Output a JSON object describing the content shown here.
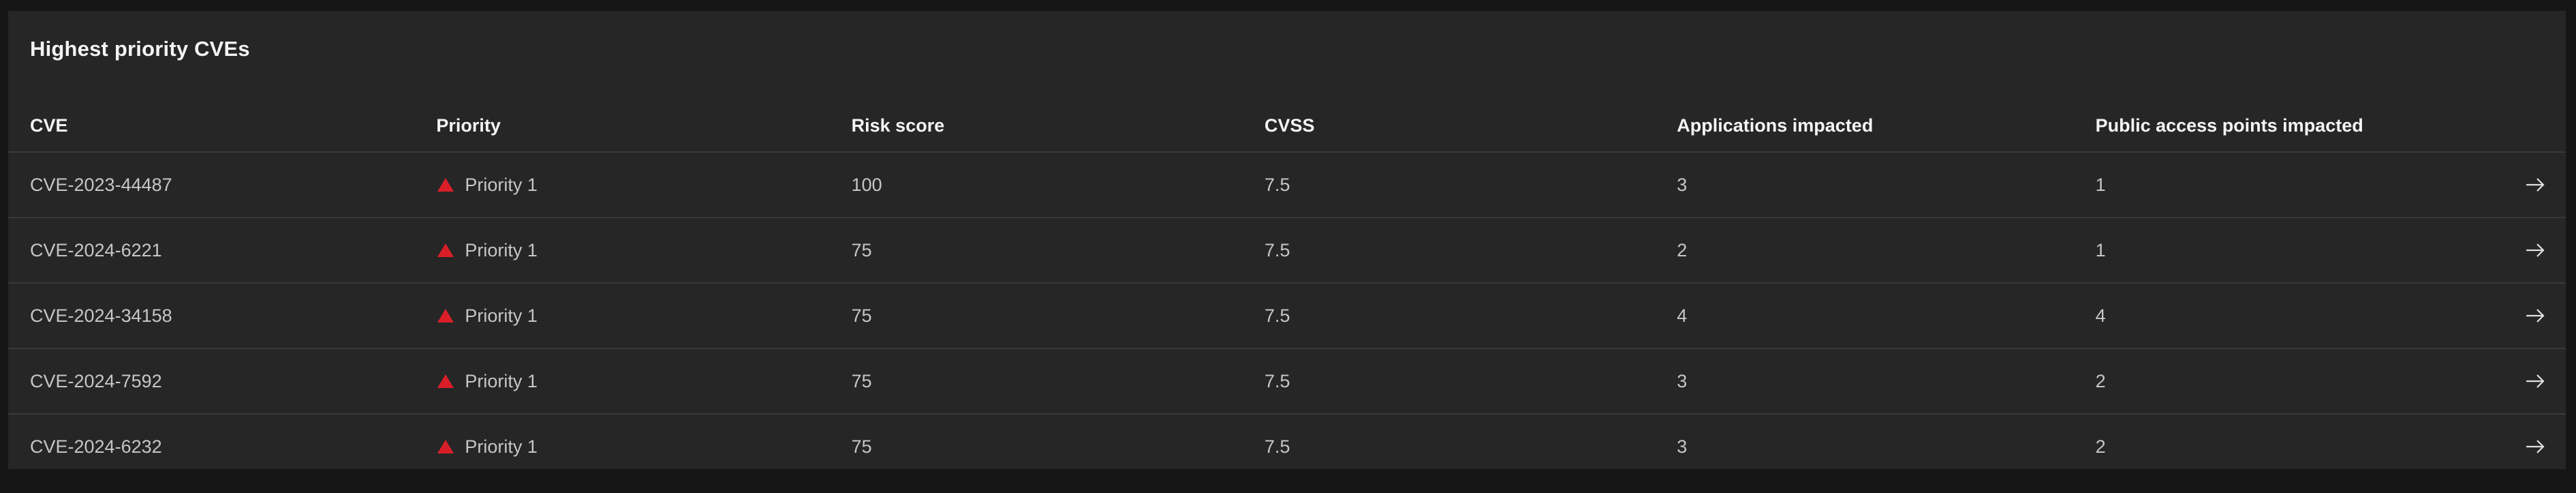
{
  "panel": {
    "title": "Highest priority CVEs"
  },
  "table": {
    "headers": [
      "CVE",
      "Priority",
      "Risk score",
      "CVSS",
      "Applications impacted",
      "Public access points impacted"
    ],
    "rows": [
      {
        "cve": "CVE-2023-44487",
        "priority": "Priority 1",
        "risk": "100",
        "cvss": "7.5",
        "apps": "3",
        "access": "1"
      },
      {
        "cve": "CVE-2024-6221",
        "priority": "Priority 1",
        "risk": "75",
        "cvss": "7.5",
        "apps": "2",
        "access": "1"
      },
      {
        "cve": "CVE-2024-34158",
        "priority": "Priority 1",
        "risk": "75",
        "cvss": "7.5",
        "apps": "4",
        "access": "4"
      },
      {
        "cve": "CVE-2024-7592",
        "priority": "Priority 1",
        "risk": "75",
        "cvss": "7.5",
        "apps": "3",
        "access": "2"
      },
      {
        "cve": "CVE-2024-6232",
        "priority": "Priority 1",
        "risk": "75",
        "cvss": "7.5",
        "apps": "3",
        "access": "2"
      }
    ],
    "row_icon": "arrow-right-icon",
    "priority_icon": "warning-triangle-icon"
  },
  "colors": {
    "background": "#161616",
    "panel": "#262626",
    "priority_red": "#da1e28",
    "header_text": "#f4f4f4",
    "body_text": "#c6c6c6"
  }
}
